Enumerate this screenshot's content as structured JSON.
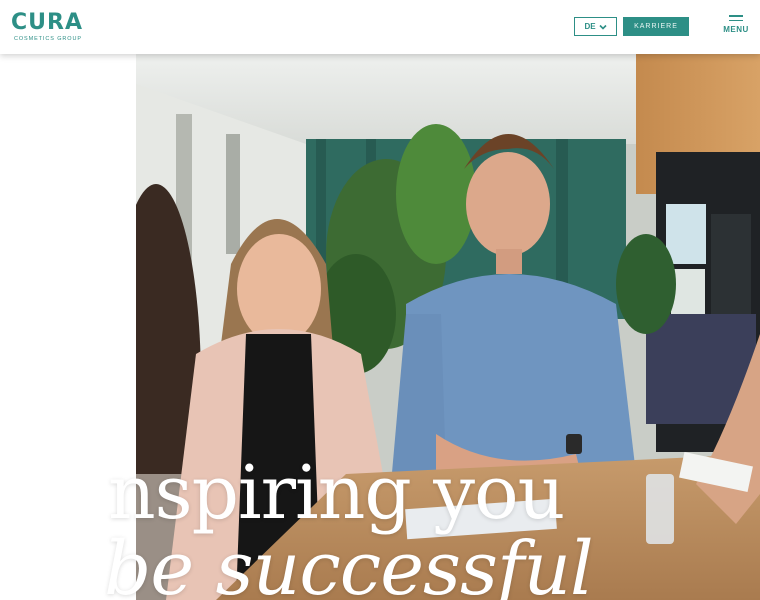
{
  "header": {
    "logo": {
      "word": "CURA",
      "tagline": "COSMETICS GROUP"
    },
    "language": {
      "selected": "DE",
      "icon": "chevron-down-icon"
    },
    "career_button": "KARRIERE",
    "menu": {
      "label": "MENU",
      "icon": "hamburger-icon"
    }
  },
  "hero": {
    "headline_line1": "nspiring you",
    "headline_line2": "be successful",
    "image": "photo-two-smiling-colleagues-at-table"
  },
  "colors": {
    "brand": "#2d8f86",
    "background": "#ffffff"
  }
}
